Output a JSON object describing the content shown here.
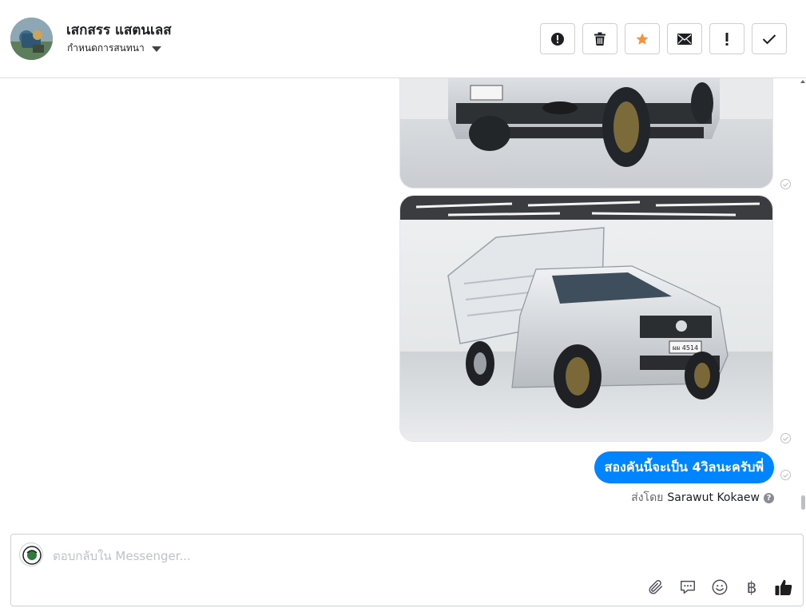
{
  "header": {
    "contact_name": "เสกสรร แสตนเลส",
    "manage_label": "กำหนดการสนทนา"
  },
  "actions": [
    {
      "name": "spam-button",
      "icon": "alert-circle-icon"
    },
    {
      "name": "delete-button",
      "icon": "trash-icon"
    },
    {
      "name": "star-button",
      "icon": "star-icon",
      "color": "#f7923b"
    },
    {
      "name": "mark-unread-button",
      "icon": "envelope-icon"
    },
    {
      "name": "important-button",
      "icon": "exclamation-icon"
    },
    {
      "name": "done-button",
      "icon": "check-icon"
    }
  ],
  "messages": {
    "text": "สองคันนี้จะเป็น 4วิลนะครับพี่",
    "bubble_color": "#0084ff",
    "plate_text": "ผผ 4514",
    "sent_by_prefix": "ส่งโดย",
    "sent_by_name": "Sarawut Kokaew"
  },
  "composer": {
    "placeholder": "ตอบกลับใน Messenger...",
    "tools": [
      "paperclip-icon",
      "saved-reply-icon",
      "emoji-icon",
      "baht-icon",
      "thumbs-up-icon"
    ],
    "baht_symbol": "฿"
  }
}
